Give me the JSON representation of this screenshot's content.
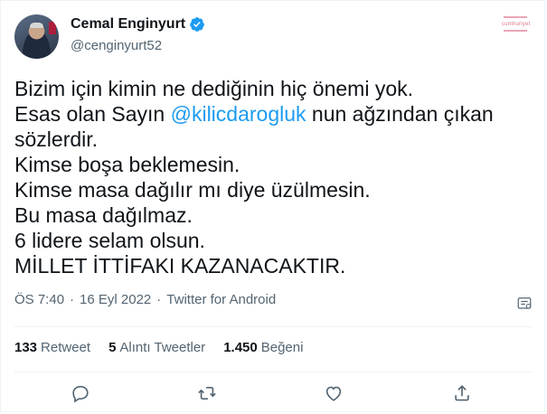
{
  "author": {
    "name": "Cemal Enginyurt",
    "handle": "@cenginyurt52",
    "verified_icon": "verified-badge-icon"
  },
  "top_right_mark": "cumhuriyet",
  "tweet": {
    "lines": [
      {
        "text": "Bizim için kimin ne dediğinin hiç önemi yok."
      },
      {
        "pre": "Esas olan Sayın ",
        "mention": "@kilicdarogluk",
        "post": " nun ağzından çıkan"
      },
      {
        "text": "sözlerdir."
      },
      {
        "text": "Kimse boşa beklemesin."
      },
      {
        "text": "Kimse masa dağılır mı diye üzülmesin."
      },
      {
        "text": "Bu masa dağılmaz."
      },
      {
        "text": "6 lidere selam olsun."
      },
      {
        "text": "MİLLET İTTİFAKI KAZANACAKTIR."
      }
    ]
  },
  "meta": {
    "time": "ÖS 7:40",
    "dot1": "·",
    "date": "16 Eyl 2022",
    "dot2": "·",
    "source": "Twitter for Android"
  },
  "stats": {
    "retweets_num": "133",
    "retweets_label": "Retweet",
    "quotes_num": "5",
    "quotes_label": "Alıntı Tweetler",
    "likes_num": "1.450",
    "likes_label": "Beğeni"
  },
  "actions": [
    "reply-icon",
    "retweet-icon",
    "like-icon",
    "share-icon"
  ],
  "colors": {
    "text": "#0f1419",
    "secondary": "#536471",
    "accent": "#1d9bf0",
    "divider": "#eff3f4"
  }
}
